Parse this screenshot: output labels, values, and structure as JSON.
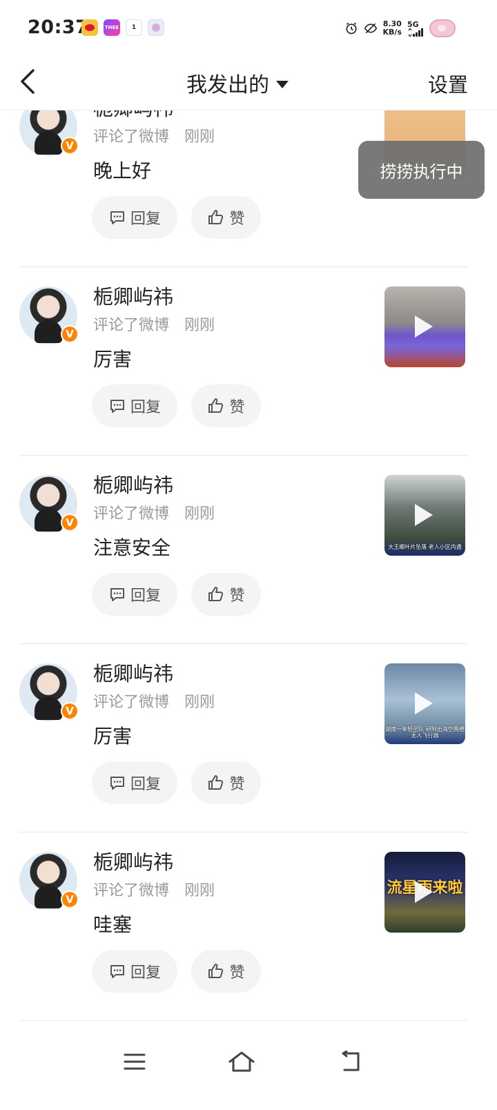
{
  "status_bar": {
    "time": "20:37",
    "apps": [
      "weibo-icon",
      "thee-app-icon",
      "one-app-icon",
      "flower-app-icon"
    ],
    "app_labels": {
      "thee": "THEE",
      "one": "1"
    },
    "speed_value": "8.30",
    "speed_unit": "KB/s",
    "network": "5G",
    "icons": [
      "alarm-icon",
      "eye-off-icon",
      "signal-icon",
      "battery-icon"
    ]
  },
  "header": {
    "title": "我发出的",
    "settings_label": "设置"
  },
  "toast": {
    "text": "捞捞执行中"
  },
  "items": [
    {
      "name": "栀卿屿祎",
      "action": "评论了微博",
      "time": "刚刚",
      "content": "晚上好",
      "reply_label": "回复",
      "like_label": "赞",
      "badge": "V"
    },
    {
      "name": "栀卿屿祎",
      "action": "评论了微博",
      "time": "刚刚",
      "content": "厉害",
      "reply_label": "回复",
      "like_label": "赞",
      "badge": "V"
    },
    {
      "name": "栀卿屿祎",
      "action": "评论了微博",
      "time": "刚刚",
      "content": "注意安全",
      "reply_label": "回复",
      "like_label": "赞",
      "badge": "V",
      "thumb_caption": "大王椰叶片坠落 老人小区内遇"
    },
    {
      "name": "栀卿屿祎",
      "action": "评论了微博",
      "time": "刚刚",
      "content": "厉害",
      "reply_label": "回复",
      "like_label": "赞",
      "badge": "V",
      "thumb_caption": "湖南一年轻团队 研制出海空两栖无人飞行器"
    },
    {
      "name": "栀卿屿祎",
      "action": "评论了微博",
      "time": "刚刚",
      "content": "哇塞",
      "reply_label": "回复",
      "like_label": "赞",
      "badge": "V",
      "thumb_caption": "流星雨来啦"
    }
  ],
  "colors": {
    "verified_badge": "#ff8200",
    "button_bg": "#f4f4f4",
    "toast_bg": "#6e6e6e"
  },
  "bottom_nav": [
    "menu-icon",
    "home-icon",
    "back-icon"
  ]
}
